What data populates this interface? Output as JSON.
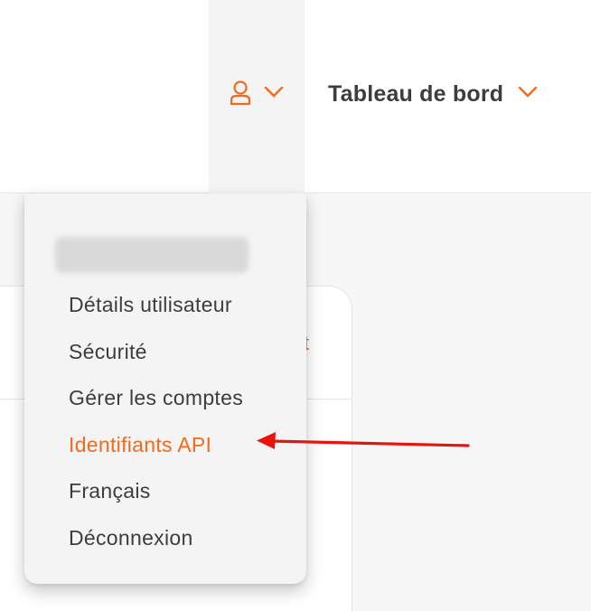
{
  "header": {
    "dashboard_label": "Tableau de bord",
    "user_icon": "user-icon",
    "chevron_icon": "chevron-down-icon"
  },
  "background": {
    "partial_text": "t"
  },
  "dropdown": {
    "items": [
      {
        "label": "Détails utilisateur",
        "active": false
      },
      {
        "label": "Sécurité",
        "active": false
      },
      {
        "label": "Gérer les comptes",
        "active": false
      },
      {
        "label": "Identifiants API",
        "active": true
      },
      {
        "label": "Français",
        "active": false
      },
      {
        "label": "Déconnexion",
        "active": false
      }
    ]
  },
  "annotation": {
    "arrow_icon": "arrow-left-icon",
    "color": "#e8140f"
  },
  "colors": {
    "accent": "#f26a1b",
    "text": "#3d3d3d",
    "menu_bg": "#f4f4f4"
  }
}
